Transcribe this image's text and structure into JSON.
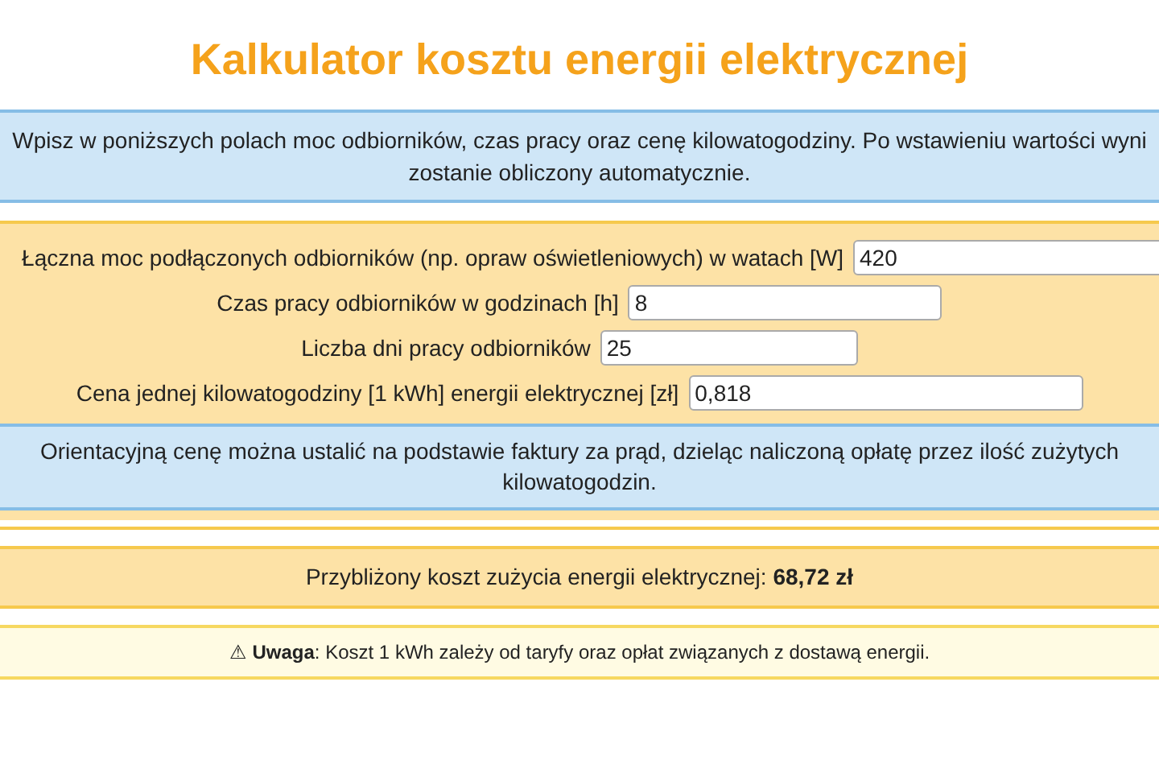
{
  "title": "Kalkulator kosztu energii elektrycznej",
  "intro": {
    "lines": [
      "Wpisz w poniższych polach moc odbiorników, czas pracy oraz cenę kilowatogodziny. Po wstawieniu wartości wyni",
      "zostanie obliczony automatycznie."
    ]
  },
  "fields": [
    {
      "label": "Łączna moc podłączonych odbiorników (np. opraw oświetleniowych) w watach [W]",
      "value": "420"
    },
    {
      "label": "Czas pracy odbiorników w godzinach [h]",
      "value": "8"
    },
    {
      "label": "Liczba dni pracy odbiorników",
      "value": "25"
    },
    {
      "label": "Cena jednej kilowatogodziny [1 kWh] energii elektrycznej [zł]",
      "value": "0,818"
    }
  ],
  "hint": "Orientacyjną cenę można ustalić na podstawie faktury za prąd, dzieląc naliczoną opłatę przez ilość zużytych kilowatogodzin.",
  "result": "Przybliżony koszt zużycia energii elektrycznej: **68,72 zł**",
  "note": "⚠ **Uwaga**: Koszt 1 kWh zależy od taryfy oraz opłat związanych z dostawą energii."
}
